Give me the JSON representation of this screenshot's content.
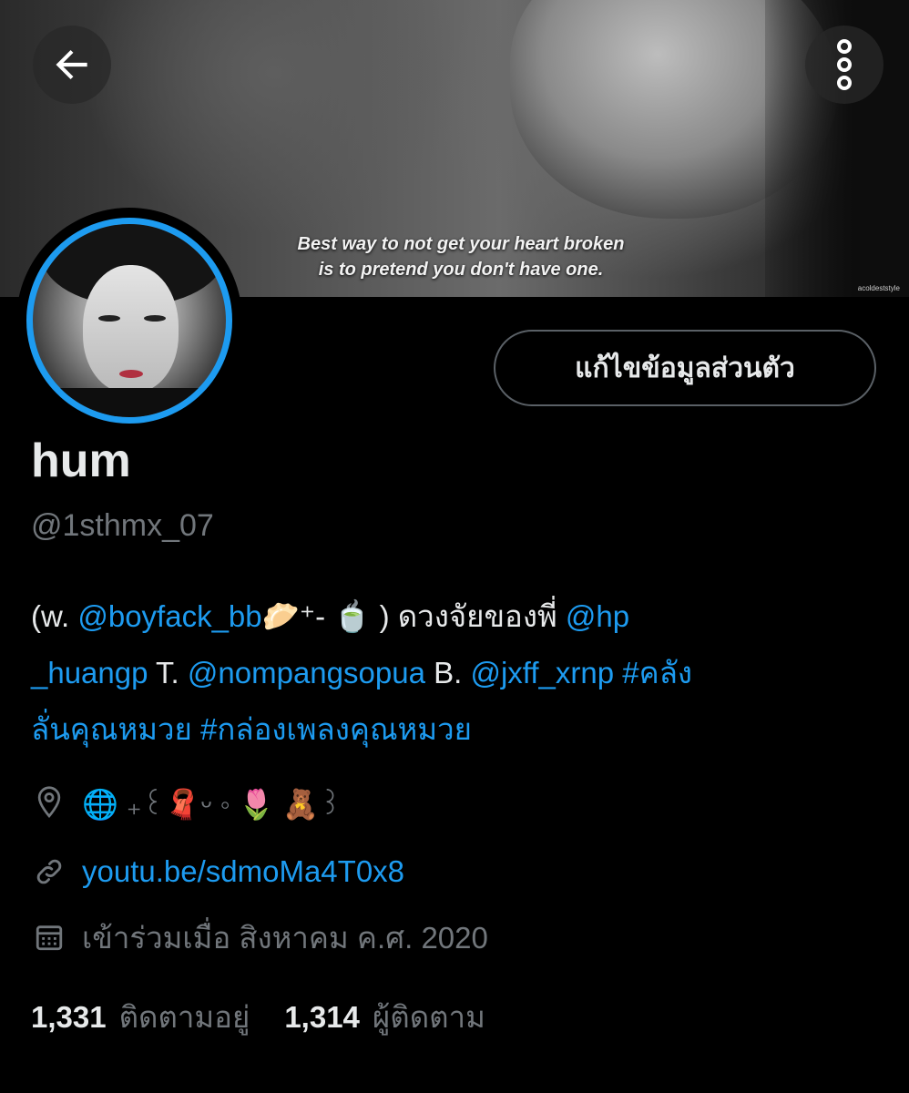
{
  "header": {
    "banner_quote_line1": "Best way to not get your heart broken",
    "banner_quote_line2": "is to pretend you don't have one.",
    "banner_watermark": "acoldeststyle",
    "back_icon": "arrow-left-icon",
    "more_icon": "more-vertical-icon"
  },
  "profile": {
    "display_name": "hum",
    "handle": "@1sthmx_07",
    "edit_button_label": "แก้ไขข้อมูลส่วนตัว",
    "avatar_ring_color": "#1d9bf0"
  },
  "bio": {
    "line1": [
      {
        "text": "(w. ",
        "type": "text"
      },
      {
        "text": "@boyfack_bb",
        "type": "mention"
      },
      {
        "text": "🥟",
        "type": "emoji"
      },
      {
        "text": "⁺- ",
        "type": "text"
      },
      {
        "text": "🍵",
        "type": "emoji"
      },
      {
        "text": " ) ดวงจัยของพี่ ",
        "type": "text"
      },
      {
        "text": "@hp",
        "type": "mention"
      }
    ],
    "line2": [
      {
        "text": "_huangp",
        "type": "mention"
      },
      {
        "text": " T.  ",
        "type": "text"
      },
      {
        "text": "@nompangsopua",
        "type": "mention"
      },
      {
        "text": " B. ",
        "type": "text"
      },
      {
        "text": "@jxff_xrnp",
        "type": "mention"
      },
      {
        "text": " ",
        "type": "text"
      },
      {
        "text": "#คลัง",
        "type": "hashtag"
      }
    ],
    "line3": [
      {
        "text": "ลั่นคุณหมวย",
        "type": "hashtag"
      },
      {
        "text": " ",
        "type": "text"
      },
      {
        "text": "#กล่องเพลงคุณหมวย",
        "type": "hashtag"
      }
    ]
  },
  "meta": {
    "location_icon": "location-pin-icon",
    "location_value": "🌐 ₊꒰🧣ᵕ ◦ 🌷 🧸꒱",
    "url_icon": "link-icon",
    "url_value": "youtu.be/sdmoMa4T0x8",
    "joined_icon": "calendar-icon",
    "joined_value": "เข้าร่วมเมื่อ สิงหาคม ค.ศ. 2020"
  },
  "stats": {
    "following_count": "1,331",
    "following_label": "ติดตามอยู่",
    "followers_count": "1,314",
    "followers_label": "ผู้ติดตาม"
  },
  "colors": {
    "background": "#000000",
    "accent": "#1d9bf0",
    "secondary_text": "#71767b",
    "primary_text": "#e7e9ea"
  }
}
